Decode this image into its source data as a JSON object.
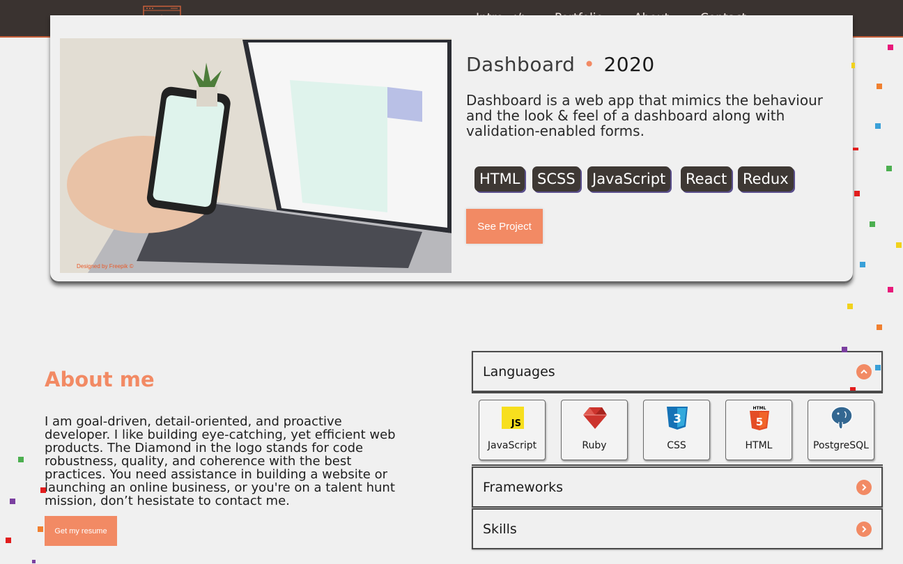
{
  "nav": {
    "links": [
      "Intro </>",
      "Portfolio",
      "About",
      "Contact"
    ]
  },
  "project": {
    "title": "Dashboard",
    "year": "2020",
    "description": "Dashboard is a web app that mimics the behaviour and the look & feel of a dashboard along with validation-enabled forms.",
    "tags": [
      "HTML",
      "SCSS",
      "JavaScript",
      "React",
      "Redux"
    ],
    "button": "See Project",
    "image_credit": "Designed by Freepik ©"
  },
  "about": {
    "title": "About me",
    "text": "I am goal-driven, detail-oriented, and proactive developer. I like building eye-catching, yet efficient web products. The Diamond in the logo stands for code robustness, quality, and coherence with the best practices. You need assistance in building a website or launching an online business, or you're on a talent hunt mission, don’t hesistate to contact me.",
    "button": "Get my resume"
  },
  "accordion": {
    "sections": [
      "Languages",
      "Frameworks",
      "Skills"
    ],
    "languages": [
      {
        "name": "JavaScript",
        "icon": "javascript-icon"
      },
      {
        "name": "Ruby",
        "icon": "ruby-icon"
      },
      {
        "name": "CSS",
        "icon": "css3-icon"
      },
      {
        "name": "HTML",
        "icon": "html5-icon"
      },
      {
        "name": "PostgreSQL",
        "icon": "postgresql-icon"
      }
    ]
  },
  "colors": {
    "nav_bg": "#3a3330",
    "accent": "#f28a64",
    "tag_bg": "#3e3834",
    "page_bg": "#f0f0f0"
  }
}
